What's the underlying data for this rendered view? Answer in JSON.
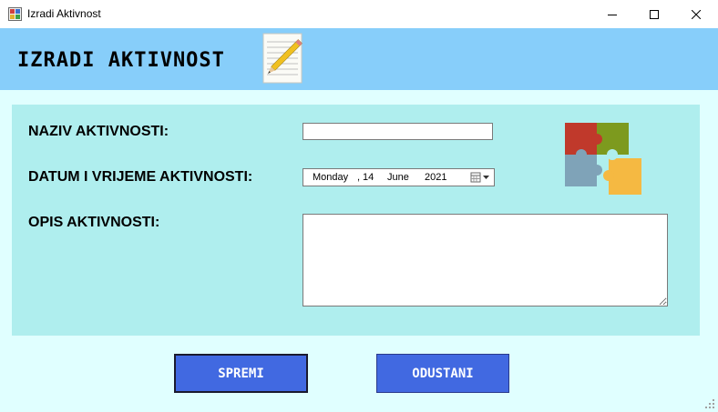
{
  "window": {
    "title": "Izradi Aktivnost"
  },
  "header": {
    "title": "IZRADI AKTIVNOST"
  },
  "form": {
    "naziv_label": "NAZIV AKTIVNOSTI:",
    "naziv_value": "",
    "datum_label": "DATUM I VRIJEME AKTIVNOSTI:",
    "date": {
      "day_name": "Monday",
      "comma": ",",
      "day": "14",
      "month": "June",
      "year": "2021"
    },
    "opis_label": "OPIS AKTIVNOSTI:",
    "opis_value": ""
  },
  "buttons": {
    "save": "SPREMI",
    "cancel": "ODUSTANI"
  },
  "colors": {
    "header_bg": "#87cefa",
    "content_bg": "#e0ffff",
    "panel_bg": "#afeeee",
    "button_bg": "#4169e1"
  },
  "icons": [
    "app-icon",
    "minimize-icon",
    "maximize-icon",
    "close-icon",
    "notepad-pencil-icon",
    "puzzle-icon",
    "calendar-dropdown-icon",
    "resize-grip-icon"
  ]
}
